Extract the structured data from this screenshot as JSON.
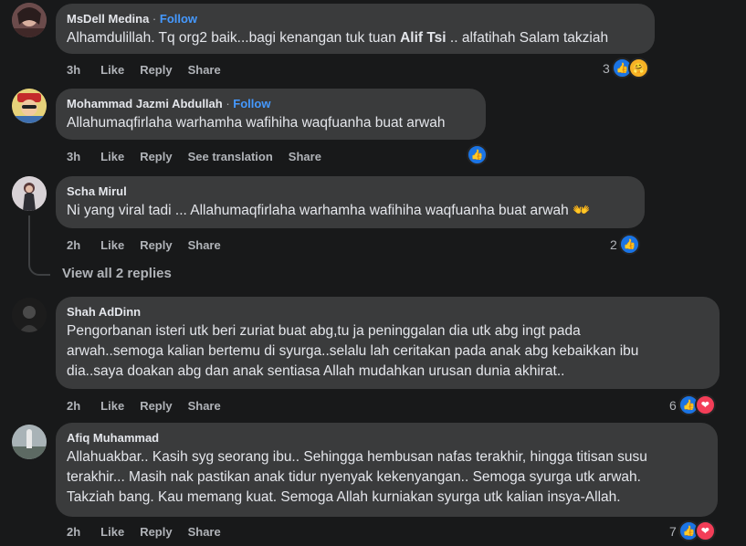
{
  "comments": [
    {
      "author": "MsDell Medina",
      "follow": "Follow",
      "text_parts": [
        "Alhamdulillah. Tq org2 baik...bagi kenangan tuk tuan ",
        "Alif Tsi",
        " .. alfatihah Salam takziah"
      ],
      "actions": [
        "3h",
        "Like",
        "Reply",
        "Share"
      ],
      "reaction_count": "3",
      "reactions": [
        "like-icon",
        "care-icon"
      ]
    },
    {
      "author": "Mohammad Jazmi Abdullah",
      "follow": "Follow",
      "text": "Allahumaqfirlaha warhamha wafihiha waqfuanha buat arwah",
      "actions": [
        "3h",
        "Like",
        "Reply",
        "See translation",
        "Share"
      ],
      "reaction_count": "",
      "reactions": [
        "like-icon"
      ]
    },
    {
      "author": "Scha Mirul",
      "text": "Ni yang viral tadi ... Allahumaqfirlaha warhamha wafihiha waqfuanha buat arwah",
      "emoji": "👐",
      "actions": [
        "2h",
        "Like",
        "Reply",
        "Share"
      ],
      "reaction_count": "2",
      "reactions": [
        "like-icon"
      ],
      "view_replies": "View all 2 replies"
    },
    {
      "author": "Shah AdDinn",
      "text_lines": [
        "Pengorbanan isteri utk beri zuriat buat abg,tu ja peninggalan dia utk abg ingt pada",
        "arwah..semoga kalian bertemu di syurga..selalu lah ceritakan pada anak abg kebaikkan ibu",
        "dia..saya doakan abg dan anak sentiasa Allah mudahkan urusan dunia akhirat.."
      ],
      "actions": [
        "2h",
        "Like",
        "Reply",
        "Share"
      ],
      "reaction_count": "6",
      "reactions": [
        "like-icon",
        "love-icon"
      ]
    },
    {
      "author": "Afiq Muhammad",
      "text_lines": [
        "Allahuakbar.. Kasih syg seorang ibu.. Sehingga hembusan nafas terakhir, hingga titisan susu",
        "terakhir... Masih nak pastikan anak tidur nyenyak kekenyangan.. Semoga syurga utk arwah.",
        "Takziah bang. Kau memang kuat. Semoga Allah kurniakan syurga utk kalian insya-Allah."
      ],
      "actions": [
        "2h",
        "Like",
        "Reply",
        "Share"
      ],
      "reaction_count": "7",
      "reactions": [
        "like-icon",
        "love-icon"
      ]
    }
  ],
  "colors": {
    "background": "#18191a",
    "bubble": "#3a3b3c",
    "text": "#e4e6eb",
    "secondary": "#b0b3b8",
    "follow": "#4599ff",
    "like": "#1b74e4",
    "love": "#f33e58"
  }
}
